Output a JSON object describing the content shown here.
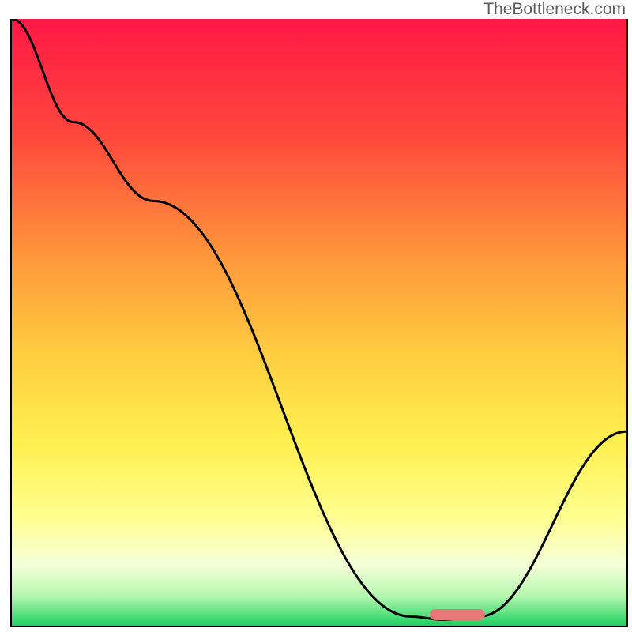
{
  "watermark": "TheBottleneck.com",
  "chart_data": {
    "type": "line",
    "title": "",
    "xlabel": "",
    "ylabel": "",
    "ylim": [
      0,
      100
    ],
    "xlim": [
      0,
      100
    ],
    "gradient_stops": [
      {
        "offset": 0,
        "color": "#ff1846"
      },
      {
        "offset": 20,
        "color": "#ff4a3c"
      },
      {
        "offset": 40,
        "color": "#ff9a3b"
      },
      {
        "offset": 55,
        "color": "#ffcc40"
      },
      {
        "offset": 70,
        "color": "#fff050"
      },
      {
        "offset": 82,
        "color": "#ffff90"
      },
      {
        "offset": 90,
        "color": "#f4ffd8"
      },
      {
        "offset": 95,
        "color": "#b8f8b0"
      },
      {
        "offset": 100,
        "color": "#1ed060"
      }
    ],
    "series": [
      {
        "name": "bottleneck-curve",
        "x": [
          0,
          10,
          23,
          65,
          70,
          76,
          100
        ],
        "y": [
          100,
          83,
          70,
          1.5,
          1,
          1.5,
          32
        ]
      }
    ],
    "marker": {
      "x_start": 68,
      "x_end": 77,
      "y": 1.8
    }
  }
}
